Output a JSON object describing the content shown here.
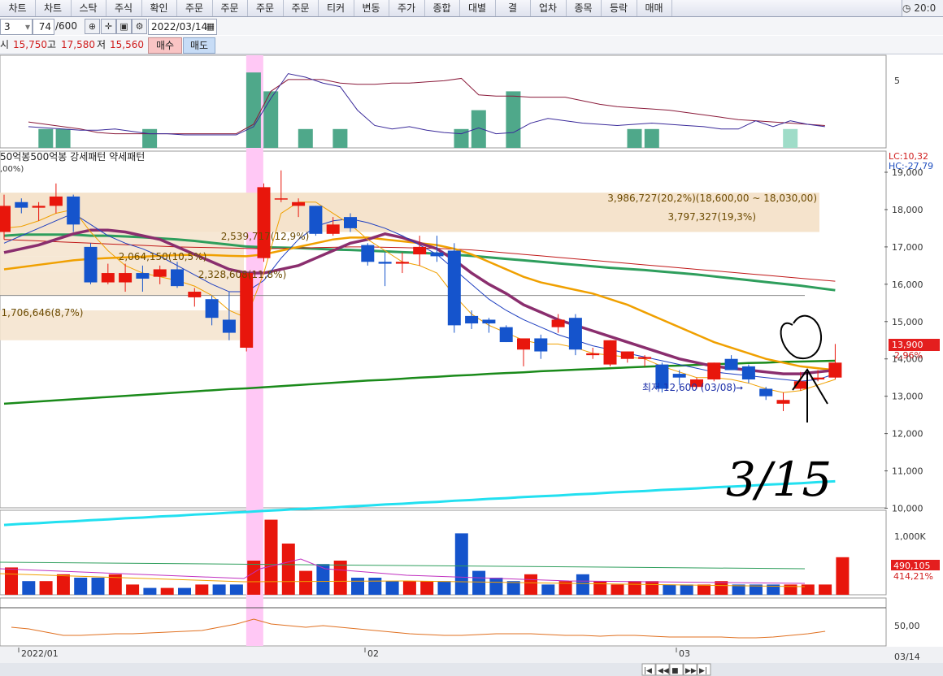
{
  "menu": [
    "차트",
    "차트",
    "스탁",
    "주식",
    "확인",
    "주문",
    "주문",
    "주문",
    "주문",
    "티커",
    "변동",
    "주가",
    "종합",
    "대별",
    "결",
    "업차",
    "종목",
    "등락",
    "매매"
  ],
  "clock": "20:0",
  "toolbar": {
    "count_left": "3",
    "count_value": "74",
    "count_total": "/600",
    "date": "2022/03/14"
  },
  "prices": {
    "open_label": "시",
    "open": "15,750",
    "high_label": "고",
    "high": "17,580",
    "low_label": "저",
    "low": "15,560",
    "buy_label": "매수",
    "sell_label": "매도"
  },
  "price_panel": {
    "title": "50억봉500억봉 강세패턴  약세패턴",
    "subtitle": ",00%)",
    "lc": "LC:10,32",
    "hc": "HC:-27,79",
    "current_price": "13,900",
    "current_change": "2,96%",
    "low_annotation": "최저 12,600 (03/08)",
    "handwriting": "3/15"
  },
  "volume_panel": {
    "current": "490,105",
    "percent": "414,21%"
  },
  "osc_panel": {
    "tick": "50,00"
  },
  "x_axis": {
    "labels": [
      "2022/01",
      "02",
      "03"
    ],
    "right_label": "03/14"
  },
  "colors": {
    "up": "#e8160c",
    "down": "#1554cc",
    "ma5": "#1e3fc0",
    "ma10": "#f0a000",
    "ma20": "#8a2e6e",
    "ma60": "#2e9e5c",
    "ma120": "#c01818",
    "ma240": "#1a8a1a",
    "ma480": "#22e0f0",
    "zone": "#f5e3cc",
    "highlight": "#ffc8f5"
  },
  "chart_data": {
    "type": "candlestick",
    "y_ticks": [
      19000,
      18000,
      17000,
      16000,
      15000,
      14000,
      13000,
      12000,
      11000,
      10000
    ],
    "y_range": [
      9500,
      19200
    ],
    "volume_ticks": [
      "1,000K"
    ],
    "zones": [
      {
        "label": "3,986,727(20,2%)(18,600,00 ~ 18,030,00)",
        "from": 17400,
        "to": 18450
      },
      {
        "label": "3,797,327(19,3%)",
        "from": 17400,
        "to": 18450
      },
      {
        "label": "2,539,717(12,9%)",
        "from": 16750,
        "to": 17400
      },
      {
        "label": "2,064,150(10,5%)",
        "from": 16350,
        "to": 16750
      },
      {
        "label": "2,328,608(11,8%)",
        "from": 15700,
        "to": 16350
      },
      {
        "label": "1,706,646(8,7%)",
        "from": 14500,
        "to": 15300
      }
    ],
    "candles": [
      {
        "o": 17400,
        "h": 18400,
        "l": 17200,
        "c": 18100,
        "v": 8
      },
      {
        "o": 18200,
        "h": 18300,
        "l": 17900,
        "c": 18050,
        "v": 4
      },
      {
        "o": 18050,
        "h": 18200,
        "l": 17700,
        "c": 18100,
        "v": 4
      },
      {
        "o": 18100,
        "h": 18700,
        "l": 17900,
        "c": 18350,
        "v": 6
      },
      {
        "o": 18350,
        "h": 18400,
        "l": 17400,
        "c": 17600,
        "v": 5
      },
      {
        "o": 17000,
        "h": 17100,
        "l": 16000,
        "c": 16050,
        "v": 5
      },
      {
        "o": 16050,
        "h": 16550,
        "l": 16000,
        "c": 16300,
        "v": 6
      },
      {
        "o": 16050,
        "h": 16550,
        "l": 15800,
        "c": 16300,
        "v": 3
      },
      {
        "o": 16300,
        "h": 16500,
        "l": 15800,
        "c": 16150,
        "v": 2
      },
      {
        "o": 16200,
        "h": 16500,
        "l": 16000,
        "c": 16400,
        "v": 2
      },
      {
        "o": 16400,
        "h": 16600,
        "l": 15900,
        "c": 15950,
        "v": 2
      },
      {
        "o": 15650,
        "h": 15900,
        "l": 15400,
        "c": 15800,
        "v": 3
      },
      {
        "o": 15600,
        "h": 15700,
        "l": 14900,
        "c": 15100,
        "v": 3
      },
      {
        "o": 15050,
        "h": 15800,
        "l": 14500,
        "c": 14700,
        "v": 3
      },
      {
        "o": 14300,
        "h": 16000,
        "l": 14200,
        "c": 16300,
        "v": 10
      },
      {
        "o": 16700,
        "h": 18700,
        "l": 16600,
        "c": 18600,
        "v": 22
      },
      {
        "o": 18300,
        "h": 19050,
        "l": 18200,
        "c": 18300,
        "v": 15
      },
      {
        "o": 18100,
        "h": 18300,
        "l": 17800,
        "c": 18200,
        "v": 7
      },
      {
        "o": 18100,
        "h": 18100,
        "l": 17300,
        "c": 17350,
        "v": 9
      },
      {
        "o": 17350,
        "h": 17800,
        "l": 17300,
        "c": 17600,
        "v": 10
      },
      {
        "o": 17800,
        "h": 17900,
        "l": 17400,
        "c": 17500,
        "v": 5
      },
      {
        "o": 17050,
        "h": 17100,
        "l": 16500,
        "c": 16600,
        "v": 5
      },
      {
        "o": 16600,
        "h": 16850,
        "l": 15950,
        "c": 16550,
        "v": 4
      },
      {
        "o": 16550,
        "h": 16850,
        "l": 16300,
        "c": 16600,
        "v": 4
      },
      {
        "o": 16800,
        "h": 17300,
        "l": 16500,
        "c": 17000,
        "v": 4
      },
      {
        "o": 16850,
        "h": 17300,
        "l": 16600,
        "c": 16750,
        "v": 4
      },
      {
        "o": 16900,
        "h": 17100,
        "l": 14700,
        "c": 14900,
        "v": 18
      },
      {
        "o": 15150,
        "h": 15300,
        "l": 14800,
        "c": 14950,
        "v": 7
      },
      {
        "o": 15050,
        "h": 15100,
        "l": 14700,
        "c": 14950,
        "v": 5
      },
      {
        "o": 14850,
        "h": 14900,
        "l": 14450,
        "c": 14450,
        "v": 4
      },
      {
        "o": 14250,
        "h": 14550,
        "l": 13800,
        "c": 14550,
        "v": 6
      },
      {
        "o": 14550,
        "h": 14650,
        "l": 14000,
        "c": 14200,
        "v": 3
      },
      {
        "o": 14850,
        "h": 15200,
        "l": 14700,
        "c": 15050,
        "v": 4
      },
      {
        "o": 15100,
        "h": 15200,
        "l": 14100,
        "c": 14250,
        "v": 6
      },
      {
        "o": 14100,
        "h": 14300,
        "l": 14000,
        "c": 14150,
        "v": 4
      },
      {
        "o": 13850,
        "h": 14500,
        "l": 13800,
        "c": 14500,
        "v": 3
      },
      {
        "o": 14000,
        "h": 14200,
        "l": 13900,
        "c": 14200,
        "v": 4
      },
      {
        "o": 14000,
        "h": 14100,
        "l": 13800,
        "c": 14050,
        "v": 4
      },
      {
        "o": 13850,
        "h": 13900,
        "l": 13100,
        "c": 13200,
        "v": 3
      },
      {
        "o": 13600,
        "h": 13700,
        "l": 13300,
        "c": 13500,
        "v": 3
      },
      {
        "o": 13250,
        "h": 13500,
        "l": 13200,
        "c": 13450,
        "v": 3
      },
      {
        "o": 13450,
        "h": 13900,
        "l": 13400,
        "c": 13900,
        "v": 4
      },
      {
        "o": 14000,
        "h": 14100,
        "l": 13700,
        "c": 13700,
        "v": 3
      },
      {
        "o": 13800,
        "h": 13850,
        "l": 13350,
        "c": 13450,
        "v": 3
      },
      {
        "o": 13200,
        "h": 13250,
        "l": 12900,
        "c": 13000,
        "v": 3
      },
      {
        "o": 12800,
        "h": 13100,
        "l": 12600,
        "c": 12900,
        "v": 3
      },
      {
        "o": 13200,
        "h": 13650,
        "l": 13150,
        "c": 13400,
        "v": 3
      },
      {
        "o": 13450,
        "h": 13700,
        "l": 13400,
        "c": 13500,
        "v": 3
      },
      {
        "o": 13500,
        "h": 14400,
        "l": 13450,
        "c": 13900,
        "v": 11
      }
    ],
    "ma": [
      {
        "key": "ma240",
        "values": [
          12800,
          12830,
          12860,
          12890,
          12920,
          12950,
          12980,
          13010,
          13040,
          13070,
          13100,
          13130,
          13160,
          13190,
          13210,
          13240,
          13270,
          13300,
          13330,
          13360,
          13390,
          13420,
          13440,
          13470,
          13500,
          13520,
          13550,
          13570,
          13600,
          13620,
          13640,
          13670,
          13690,
          13710,
          13730,
          13750,
          13770,
          13790,
          13810,
          13820,
          13840,
          13860,
          13870,
          13890,
          13900,
          13920,
          13930,
          13940,
          13950
        ],
        "width": 2.5
      },
      {
        "key": "ma480",
        "values": [
          9550,
          9580,
          9600,
          9630,
          9650,
          9680,
          9700,
          9730,
          9750,
          9780,
          9800,
          9830,
          9850,
          9880,
          9900,
          9930,
          9950,
          9980,
          10000,
          10020,
          10050,
          10070,
          10100,
          10120,
          10150,
          10170,
          10200,
          10220,
          10250,
          10270,
          10300,
          10320,
          10340,
          10370,
          10390,
          10420,
          10440,
          10460,
          10490,
          10510,
          10530,
          10560,
          10580,
          10600,
          10630,
          10650,
          10670,
          10700,
          10720
        ],
        "width": 3
      },
      {
        "key": "ma60",
        "values": [
          17300,
          17330,
          17330,
          17330,
          17330,
          17300,
          17300,
          17280,
          17260,
          17230,
          17200,
          17160,
          17110,
          17060,
          17010,
          16990,
          16980,
          16970,
          16950,
          16930,
          16920,
          16900,
          16880,
          16860,
          16840,
          16820,
          16790,
          16760,
          16720,
          16680,
          16640,
          16600,
          16560,
          16520,
          16480,
          16440,
          16410,
          16380,
          16340,
          16300,
          16260,
          16210,
          16160,
          16110,
          16060,
          16010,
          15960,
          15900,
          15840
        ],
        "width": 3
      },
      {
        "key": "ma120",
        "values": [
          17200,
          17180,
          17160,
          17140,
          17120,
          17100,
          17080,
          17060,
          17040,
          17020,
          17000,
          16990,
          16980,
          16970,
          16960,
          16950,
          16960,
          16970,
          16980,
          16990,
          17000,
          17000,
          16990,
          16980,
          16970,
          16960,
          16940,
          16920,
          16880,
          16840,
          16800,
          16760,
          16720,
          16680,
          16640,
          16600,
          16560,
          16520,
          16480,
          16440,
          16400,
          16360,
          16320,
          16280,
          16240,
          16200,
          16160,
          16120,
          16080
        ],
        "width": 1
      },
      {
        "key": "ma10",
        "values": [
          16400,
          16460,
          16520,
          16580,
          16640,
          16680,
          16700,
          16720,
          16740,
          16760,
          16780,
          16790,
          16780,
          16760,
          16750,
          16800,
          16900,
          17000,
          17100,
          17200,
          17250,
          17250,
          17200,
          17150,
          17100,
          17050,
          16950,
          16800,
          16600,
          16400,
          16200,
          16050,
          15950,
          15850,
          15750,
          15600,
          15450,
          15250,
          15050,
          14850,
          14650,
          14450,
          14300,
          14150,
          14000,
          13900,
          13800,
          13750,
          13700
        ],
        "width": 2.5
      },
      {
        "key": "ma20",
        "values": [
          16850,
          16950,
          17050,
          17200,
          17350,
          17450,
          17450,
          17400,
          17300,
          17200,
          17000,
          16800,
          16600,
          16400,
          16300,
          16300,
          16400,
          16500,
          16700,
          16900,
          17100,
          17200,
          17350,
          17250,
          17100,
          16950,
          16650,
          16300,
          16000,
          15750,
          15450,
          15250,
          15050,
          14900,
          14750,
          14600,
          14450,
          14300,
          14150,
          14000,
          13900,
          13800,
          13750,
          13700,
          13650,
          13600,
          13600,
          13650,
          13700
        ],
        "width": 3.5
      },
      {
        "key": "ma5",
        "values": [
          17100,
          17300,
          17500,
          17700,
          17900,
          17600,
          17300,
          17100,
          16950,
          16750,
          16500,
          16250,
          16000,
          15800,
          15800,
          16100,
          16700,
          17200,
          17550,
          17700,
          17750,
          17650,
          17500,
          17300,
          17050,
          16800,
          16400,
          16000,
          15600,
          15300,
          15050,
          14850,
          14650,
          14500,
          14350,
          14250,
          14150,
          14050,
          13950,
          13850,
          13750,
          13650,
          13600,
          13550,
          13500,
          13450,
          13400,
          13450,
          13600
        ],
        "width": 1
      },
      {
        "key": "ma_orange_thin",
        "values": [
          17500,
          17550,
          17700,
          17900,
          18000,
          17400,
          16900,
          16500,
          16300,
          16200,
          16100,
          15950,
          15700,
          15300,
          15100,
          16300,
          17900,
          18200,
          18200,
          17900,
          17600,
          17200,
          16900,
          16600,
          16500,
          16300,
          15700,
          15200,
          14900,
          14700,
          14500,
          14400,
          14400,
          14300,
          14150,
          14100,
          14050,
          14000,
          13800,
          13650,
          13500,
          13500,
          13450,
          13350,
          13200,
          13100,
          13150,
          13300,
          13450
        ],
        "width": 1
      }
    ],
    "top_indicator": {
      "bars": [
        0,
        1,
        1,
        0,
        0,
        0,
        0,
        1,
        0,
        0,
        0,
        0,
        0,
        4,
        3,
        0,
        1,
        0,
        1,
        0,
        0,
        0,
        0,
        0,
        0,
        1,
        2,
        0,
        3,
        0,
        0,
        0,
        0,
        0,
        0,
        1,
        1,
        0,
        0,
        0,
        0,
        0,
        0,
        0,
        1,
        0,
        0
      ],
      "line_a": [
        2.2,
        2.0,
        1.8,
        1.6,
        1.3,
        1.2,
        1.2,
        1.2,
        1.2,
        1.2,
        1.2,
        1.2,
        1.2,
        2.0,
        4.8,
        5.8,
        5.8,
        5.8,
        5.5,
        5.4,
        5.4,
        5.5,
        5.5,
        5.6,
        5.7,
        5.9,
        4.5,
        4.4,
        4.4,
        4.3,
        4.3,
        4.3,
        4.0,
        3.7,
        3.5,
        3.4,
        3.3,
        3.2,
        3.0,
        2.8,
        2.6,
        2.4,
        2.3,
        2.2,
        2.1,
        2.0,
        1.9
      ],
      "line_b": [
        1.8,
        1.7,
        1.6,
        1.5,
        1.5,
        1.6,
        1.4,
        1.2,
        1.2,
        1.1,
        1.1,
        1.1,
        1.1,
        1.8,
        4.2,
        6.3,
        6.0,
        5.5,
        5.2,
        3.2,
        1.9,
        1.6,
        1.8,
        1.5,
        1.3,
        1.2,
        1.7,
        1.2,
        1.3,
        2.1,
        2.5,
        2.3,
        2.1,
        2.0,
        1.9,
        2.0,
        2.1,
        2.0,
        1.9,
        1.8,
        1.6,
        1.6,
        2.3,
        1.8,
        2.3,
        2.0,
        1.8
      ]
    }
  }
}
